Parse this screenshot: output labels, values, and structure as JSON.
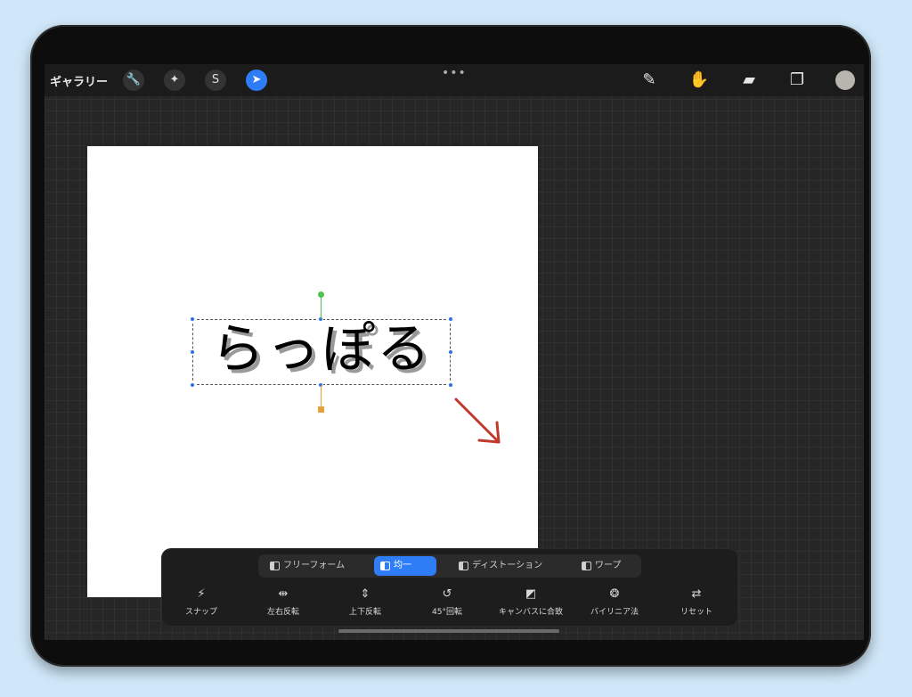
{
  "topbar": {
    "gallery_label": "ギャラリー",
    "tools_left": [
      {
        "name": "wrench-icon",
        "glyph": "🔧"
      },
      {
        "name": "magic-wand-icon",
        "glyph": "✦"
      },
      {
        "name": "selection-s-icon",
        "glyph": "S"
      },
      {
        "name": "transform-arrow-icon",
        "glyph": "➤",
        "active": true
      }
    ],
    "dots": "•••",
    "tools_right": [
      {
        "name": "brush-icon",
        "glyph": "✎"
      },
      {
        "name": "smudge-icon",
        "glyph": "✋"
      },
      {
        "name": "eraser-icon",
        "glyph": "▰"
      },
      {
        "name": "layers-icon",
        "glyph": "❐"
      }
    ],
    "color_swatch": "#b8b4ae"
  },
  "canvas": {
    "text": "らっぽる",
    "annotation_arrow_color": "#c0392b"
  },
  "transform_panel": {
    "modes": [
      {
        "label": "フリーフォーム",
        "active": false
      },
      {
        "label": "均一",
        "active": true
      },
      {
        "label": "ディストーション",
        "active": false
      },
      {
        "label": "ワープ",
        "active": false
      }
    ],
    "actions": [
      {
        "label": "スナップ",
        "icon": "⚡"
      },
      {
        "label": "左右反転",
        "icon": "⇹"
      },
      {
        "label": "上下反転",
        "icon": "⇕"
      },
      {
        "label": "45°回転",
        "icon": "↺"
      },
      {
        "label": "キャンバスに合致",
        "icon": "◩"
      },
      {
        "label": "バイリニア法",
        "icon": "❂"
      },
      {
        "label": "リセット",
        "icon": "⇄"
      }
    ]
  },
  "colors": {
    "accent": "#2f7df6",
    "background": "#cfe7f8"
  }
}
